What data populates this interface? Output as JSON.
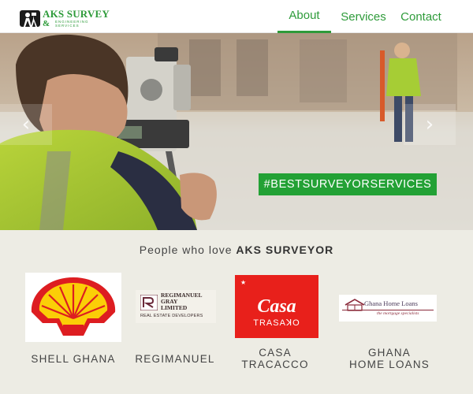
{
  "header": {
    "logo": {
      "brand": "AKS SURVEY",
      "ampersand": "&",
      "tagline_line1": "ENGINEERING",
      "tagline_line2": "SERVICES"
    },
    "nav": {
      "about": "About",
      "services": "Services",
      "contact": "Contact",
      "active": "about"
    }
  },
  "hero": {
    "prev_icon": "chevron-left-icon",
    "next_icon": "chevron-right-icon",
    "hashtag": "#BESTSURVEYORSERVICES"
  },
  "clients": {
    "heading_prefix": "People who love ",
    "heading_brand": "AKS SURVEYOR",
    "items": [
      {
        "name": "SHELL GHANA"
      },
      {
        "name": "REGIMANUEL",
        "logo_line1": "REGIMANUEL",
        "logo_line2": "GRAY",
        "logo_line3": "LIMITED",
        "logo_line4": "REAL ESTATE DEVELOPERS"
      },
      {
        "name_line1": "CASA",
        "name_line2": "TRACACCO",
        "logo_word1": "Casa",
        "logo_word2": "TRASAꓘO"
      },
      {
        "name_line1": "GHANA",
        "name_line2": "HOME LOANS",
        "logo_title": "Ghana Home Loans",
        "logo_tagline": "the mortgage specialists"
      }
    ]
  },
  "colors": {
    "brand_green": "#2e9b3a",
    "hashtag_bg": "#23a135",
    "clients_bg": "#edece4",
    "casa_red": "#e8201b",
    "shell_red": "#dd1d21",
    "shell_yellow": "#fbce07"
  }
}
